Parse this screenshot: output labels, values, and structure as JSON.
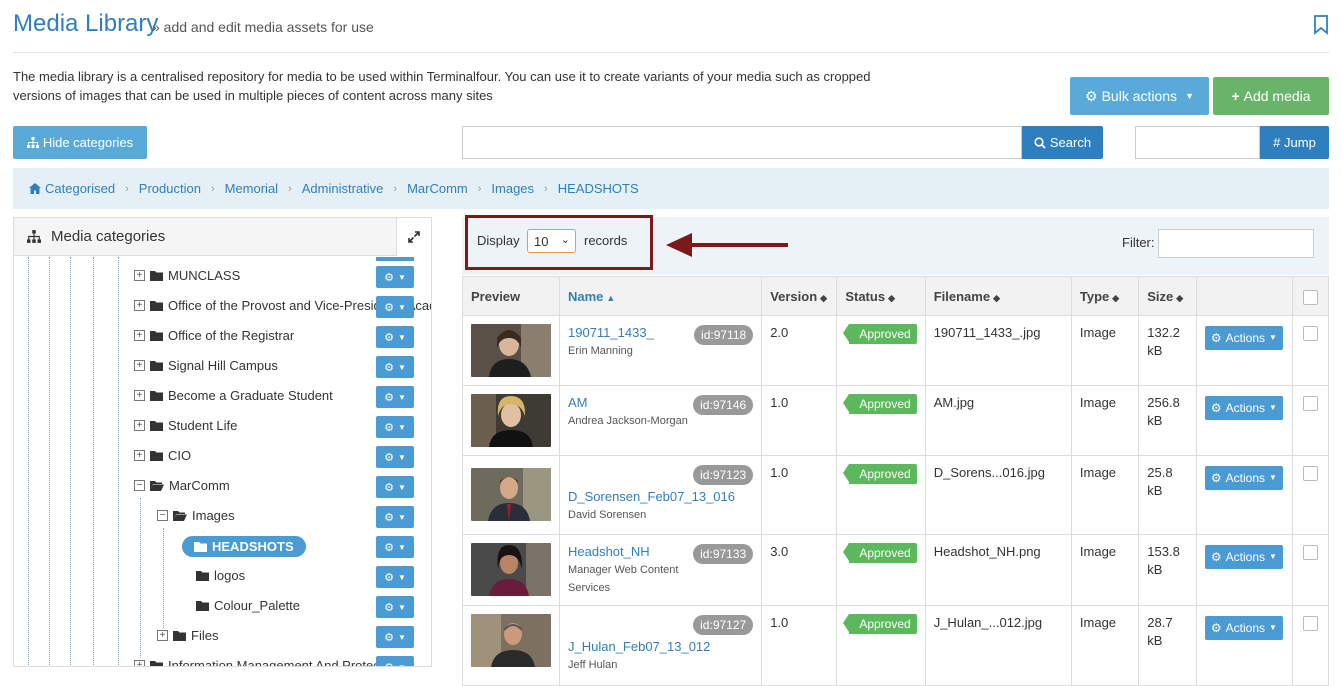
{
  "header": {
    "title": "Media Library",
    "subtitle": "» add and edit media assets for use"
  },
  "intro": "The media library is a centralised repository for media to be used within Terminalfour. You can use it to create variants of your media such as cropped versions of images that can be used in multiple pieces of content across many sites",
  "toolbar": {
    "bulk_label": "Bulk actions",
    "add_label": "Add media",
    "hide_categories": "Hide categories",
    "search_label": "Search",
    "jump_label": "# Jump"
  },
  "breadcrumb": [
    "Categorised",
    "Production",
    "Memorial",
    "Administrative",
    "MarComm",
    "Images",
    "HEADSHOTS"
  ],
  "categories": {
    "title": "Media categories",
    "items": [
      "MUNCLASS",
      "Office of the Provost and Vice-President (Academic)",
      "Office of the Registrar",
      "Signal Hill Campus",
      "Become a Graduate Student",
      "Student Life",
      "CIO",
      "MarComm",
      "Images",
      "HEADSHOTS",
      "logos",
      "Colour_Palette",
      "Files",
      "Information Management And Protection"
    ]
  },
  "grid": {
    "display_label": "Display",
    "display_value": "10",
    "records_label": "records",
    "filter_label": "Filter:",
    "columns": [
      "Preview",
      "Name",
      "Version",
      "Status",
      "Filename",
      "Type",
      "Size"
    ],
    "rows": [
      {
        "name": "190711_1433_",
        "sub": "Erin Manning",
        "id": "id:97118",
        "version": "2.0",
        "status": "Approved",
        "filename": "190711_1433_.jpg",
        "type": "Image",
        "size1": "132.2",
        "size2": "kB",
        "action": "Actions"
      },
      {
        "name": "AM",
        "sub": "Andrea Jackson-Morgan",
        "id": "id:97146",
        "version": "1.0",
        "status": "Approved",
        "filename": "AM.jpg",
        "type": "Image",
        "size1": "256.8",
        "size2": "kB",
        "action": "Actions"
      },
      {
        "name": "D_Sorensen_Feb07_13_016",
        "sub": "David Sorensen",
        "id": "id:97123",
        "version": "1.0",
        "status": "Approved",
        "filename": "D_Sorens...016.jpg",
        "type": "Image",
        "size1": "25.8",
        "size2": "kB",
        "action": "Actions"
      },
      {
        "name": "Headshot_NH",
        "sub": "Manager Web Content Services",
        "id": "id:97133",
        "version": "3.0",
        "status": "Approved",
        "filename": "Headshot_NH.png",
        "type": "Image",
        "size1": "153.8",
        "size2": "kB",
        "action": "Actions"
      },
      {
        "name": "J_Hulan_Feb07_13_012",
        "sub": "Jeff Hulan",
        "id": "id:97127",
        "version": "1.0",
        "status": "Approved",
        "filename": "J_Hulan_...012.jpg",
        "type": "Image",
        "size1": "28.7",
        "size2": "kB",
        "action": "Actions"
      }
    ]
  }
}
